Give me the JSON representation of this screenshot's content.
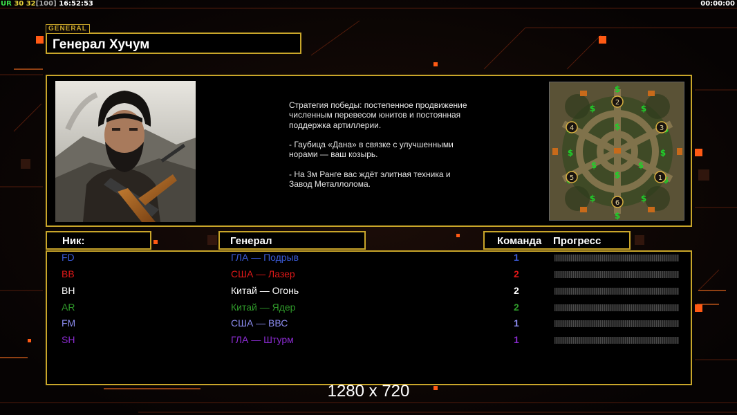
{
  "hud": {
    "version_label": "UR",
    "num_a": "30",
    "num_b": "32",
    "bracket_value": "[100]",
    "clock": "16:52:53",
    "timer": "00:00:00"
  },
  "general_tag": "GENERAL",
  "general_name": "Генерал Хучум",
  "strategy_text": "Стратегия победы: постепенное продвижение численным перевесом юнитов и постоянная поддержка артиллерии.\n\n- Гаубица «Дана» в связке с улучшенными норами — ваш козырь.\n\n- На 3м Ранге вас ждёт элитная техника и Завод Металлолома.",
  "minimap": {
    "start_positions": [
      "1",
      "2",
      "3",
      "4",
      "5",
      "6"
    ],
    "resource_icon": "$"
  },
  "columns": {
    "nick": "Ник:",
    "general": "Генерал",
    "team": "Команда",
    "progress": "Прогресс"
  },
  "players": [
    {
      "nick": "FD",
      "general": "ГЛА — Подрыв",
      "team": "1",
      "color": "#3b5bd9",
      "progress": 0
    },
    {
      "nick": "BB",
      "general": "США — Лазер",
      "team": "2",
      "color": "#e01818",
      "progress": 0
    },
    {
      "nick": "BH",
      "general": "Китай — Огонь",
      "team": "2",
      "color": "#ffffff",
      "progress": 0
    },
    {
      "nick": "AR",
      "general": "Китай — Ядер",
      "team": "2",
      "color": "#2f9a2a",
      "progress": 0
    },
    {
      "nick": "FM",
      "general": "США — ВВС",
      "team": "1",
      "color": "#8c8cf0",
      "progress": 0
    },
    {
      "nick": "SH",
      "general": "ГЛА — Штурм",
      "team": "1",
      "color": "#8a2bd0",
      "progress": 0
    }
  ],
  "resolution_label": "1280 x 720",
  "colors": {
    "frame_gold": "#c9a62a",
    "accent_orange": "#ff6a1a",
    "hud_green": "#3ce04a",
    "hud_yellow": "#e8d23a"
  }
}
